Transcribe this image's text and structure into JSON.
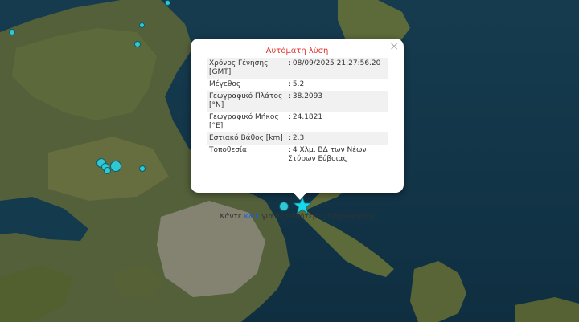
{
  "popup": {
    "title": "Αυτόματη λύση",
    "close_symbol": "×",
    "rows": [
      {
        "key": "Χρόνος Γένησης [GMT]",
        "value": ": 08/09/2025 21:27:56.20"
      },
      {
        "key": "Μέγεθος",
        "value": ": 5.2"
      },
      {
        "key": "Γεωγραφικό Πλάτος [°N]",
        "value": ": 38.2093"
      },
      {
        "key": "Γεωγραφικό Μήκος [°E]",
        "value": ": 24.1821"
      },
      {
        "key": "Εστιακό Βάθος [km]",
        "value": ": 2.3"
      },
      {
        "key": "Τοποθεσία",
        "value": ": 4 Χλμ. ΒΔ των Νέων Στύρων Εύβοιας"
      }
    ],
    "footer_before": "Κάντε ",
    "footer_link": "κλικ",
    "footer_after": " για περισσότερες πληροφορίες"
  },
  "colors": {
    "sea": "#123547",
    "land": "#4d5a34",
    "marker": "#31c8d6",
    "epicenter": "#18d8ee",
    "title_red": "#e0332d",
    "link_blue": "#1a5fd6"
  },
  "markers": {
    "epicenter_icon": "star-icon",
    "event_icon": "circle-icon"
  }
}
